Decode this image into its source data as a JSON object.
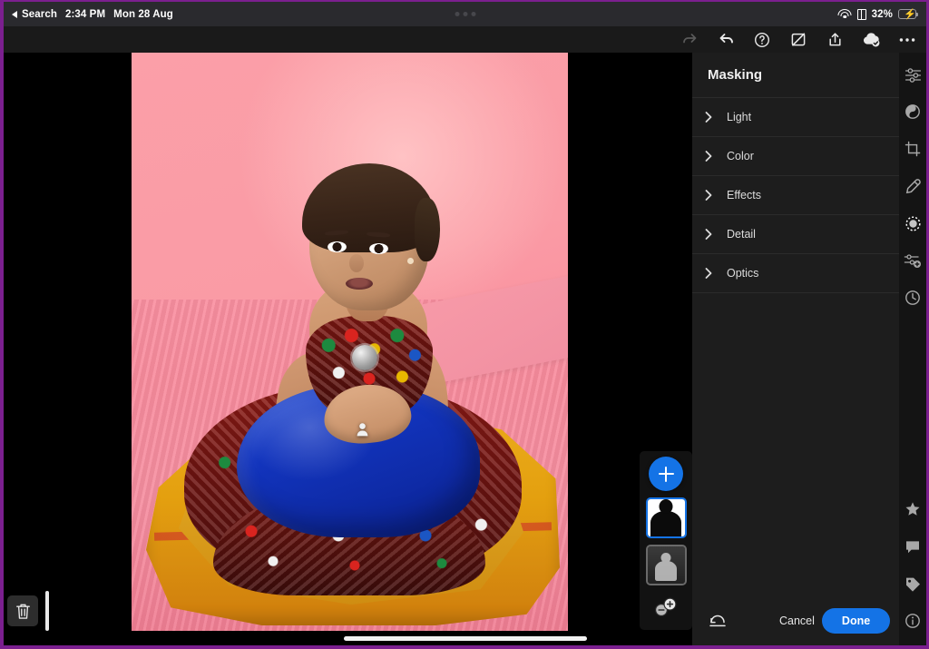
{
  "status_bar": {
    "back_label": "Search",
    "time": "2:34 PM",
    "date": "Mon 28 Aug",
    "battery_percent": "32%",
    "wifi_icon": "wifi-icon",
    "book_icon": "book-icon",
    "battery_icon": "battery-charging-icon",
    "center_dots_icon": "dynamic-island-dots-icon"
  },
  "toolbar": {
    "items": [
      {
        "name": "redo-button",
        "icon": "redo-arrow-icon",
        "label": "Redo",
        "disabled": true
      },
      {
        "name": "undo-button",
        "icon": "undo-arrow-icon",
        "label": "Undo",
        "disabled": false
      },
      {
        "name": "help-button",
        "icon": "question-circle-icon",
        "label": "Help",
        "disabled": false
      },
      {
        "name": "hide-edits-button",
        "icon": "eye-slash-square-icon",
        "label": "Show Original",
        "disabled": false
      },
      {
        "name": "share-button",
        "icon": "share-up-arrow-icon",
        "label": "Share",
        "disabled": false
      },
      {
        "name": "cloud-sync-button",
        "icon": "cloud-check-icon",
        "label": "Synced",
        "disabled": false
      },
      {
        "name": "more-button",
        "icon": "ellipsis-icon",
        "label": "More",
        "disabled": false
      }
    ]
  },
  "panel": {
    "title": "Masking",
    "rows": [
      {
        "label": "Light",
        "icon": "chevron-right-icon"
      },
      {
        "label": "Color",
        "icon": "chevron-right-icon"
      },
      {
        "label": "Effects",
        "icon": "chevron-right-icon"
      },
      {
        "label": "Detail",
        "icon": "chevron-right-icon"
      },
      {
        "label": "Optics",
        "icon": "chevron-right-icon"
      }
    ],
    "footer": {
      "reset_icon": "reset-arc-icon",
      "cancel_label": "Cancel",
      "done_label": "Done"
    }
  },
  "rail": {
    "top_items": [
      {
        "name": "edit-sliders-icon",
        "label": "Edit",
        "active": false
      },
      {
        "name": "presets-circle-icon",
        "label": "Presets",
        "active": false
      },
      {
        "name": "crop-icon",
        "label": "Crop",
        "active": false
      },
      {
        "name": "healing-brush-icon",
        "label": "Healing",
        "active": false
      },
      {
        "name": "masking-dotted-circle-icon",
        "label": "Masking",
        "active": true
      },
      {
        "name": "mask-add-node-icon",
        "label": "Add Mask",
        "active": false
      },
      {
        "name": "history-clock-icon",
        "label": "Versions",
        "active": false
      }
    ],
    "bottom_items": [
      {
        "name": "star-rating-icon",
        "label": "Rate",
        "active": false
      },
      {
        "name": "comment-bubble-icon",
        "label": "Comments",
        "active": false
      },
      {
        "name": "keyword-tag-icon",
        "label": "Keywords",
        "active": false
      },
      {
        "name": "info-circle-icon",
        "label": "Info",
        "active": false
      }
    ]
  },
  "mask_panel": {
    "add_button_label": "+",
    "add_button_icon": "plus-icon",
    "thumbnails": [
      {
        "name": "mask-thumbnail-subject",
        "label": "Subject 1",
        "selected": true,
        "type": "silhouette"
      },
      {
        "name": "mask-thumbnail-preview",
        "label": "Mask Preview",
        "selected": false,
        "type": "grayscale"
      }
    ],
    "ops_icon": "add-subtract-circles-icon",
    "ops_label": "Add / Subtract"
  },
  "stage": {
    "trash_icon": "trash-icon",
    "trash_label": "Delete",
    "filmstrip_handle_label": "Filmstrip Handle",
    "subject_pin_icon": "person-pin-icon",
    "subject_pin_label": "Subject Mask Pin",
    "photo_alt": "Toddler in traditional Indian outfit seated on embroidered cloth against a pink backdrop"
  },
  "home_indicator_label": "Home Indicator",
  "colors": {
    "accent_blue": "#1473e6",
    "panel_bg": "#1d1d1d",
    "rail_bg": "#141414",
    "toolbar_bg": "#1a1a1a",
    "statusbar_bg": "#2a2a2e",
    "battery_green": "#30d158",
    "frame_purple": "#7b1f8f",
    "rail_active_indicator": "#b86ad9"
  }
}
